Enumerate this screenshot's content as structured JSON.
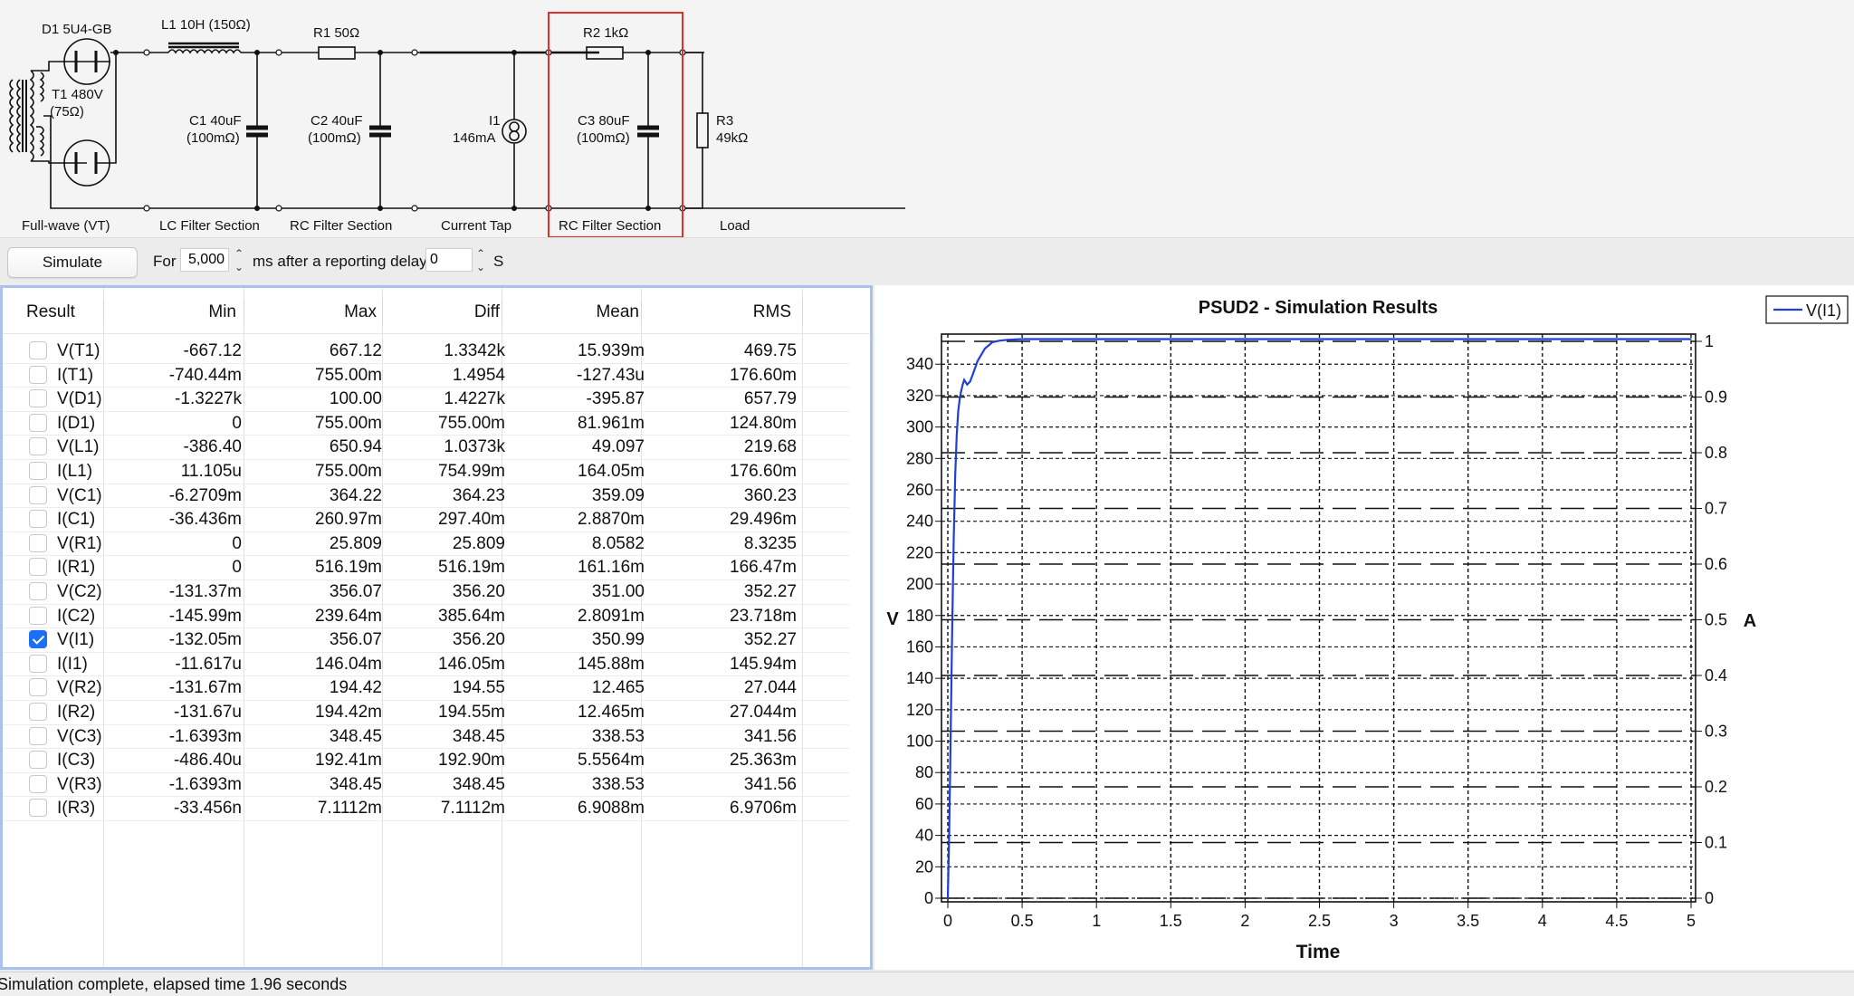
{
  "circuit": {
    "sections": [
      {
        "name": "Full-wave (VT)"
      },
      {
        "name": "LC Filter Section"
      },
      {
        "name": "RC Filter Section"
      },
      {
        "name": "Current Tap"
      },
      {
        "name": "RC Filter Section"
      },
      {
        "name": "Load"
      }
    ],
    "components": {
      "d1": "D1 5U4-GB",
      "t1_a": "T1 480V",
      "t1_b": "(75Ω)",
      "l1": "L1 10H (150Ω)",
      "r1": "R1 50Ω",
      "r2": "R2 1kΩ",
      "c1_a": "C1 40uF",
      "c1_b": "(100mΩ)",
      "c2_a": "C2 40uF",
      "c2_b": "(100mΩ)",
      "i1_a": "I1",
      "i1_b": "146mA",
      "c3_a": "C3 80uF",
      "c3_b": "(100mΩ)",
      "r3_a": "R3",
      "r3_b": "49kΩ"
    },
    "selected_section_color": "#e0302a"
  },
  "controls": {
    "simulate_label": "Simulate",
    "for_label": "For",
    "duration_value": "5,000",
    "delay_label": "ms after a reporting delay",
    "delay_value": "0",
    "delay_unit": "S"
  },
  "table": {
    "headers": [
      "Result",
      "Min",
      "Max",
      "Diff",
      "Mean",
      "RMS"
    ],
    "rows": [
      {
        "name": "V(T1)",
        "min": "-667.12",
        "max": "667.12",
        "diff": "1.3342k",
        "mean": "15.939m",
        "rms": "469.75",
        "checked": false
      },
      {
        "name": "I(T1)",
        "min": "-740.44m",
        "max": "755.00m",
        "diff": "1.4954",
        "mean": "-127.43u",
        "rms": "176.60m",
        "checked": false
      },
      {
        "name": "V(D1)",
        "min": "-1.3227k",
        "max": "100.00",
        "diff": "1.4227k",
        "mean": "-395.87",
        "rms": "657.79",
        "checked": false
      },
      {
        "name": "I(D1)",
        "min": "0",
        "max": "755.00m",
        "diff": "755.00m",
        "mean": "81.961m",
        "rms": "124.80m",
        "checked": false
      },
      {
        "name": "V(L1)",
        "min": "-386.40",
        "max": "650.94",
        "diff": "1.0373k",
        "mean": "49.097",
        "rms": "219.68",
        "checked": false
      },
      {
        "name": "I(L1)",
        "min": "11.105u",
        "max": "755.00m",
        "diff": "754.99m",
        "mean": "164.05m",
        "rms": "176.60m",
        "checked": false
      },
      {
        "name": "V(C1)",
        "min": "-6.2709m",
        "max": "364.22",
        "diff": "364.23",
        "mean": "359.09",
        "rms": "360.23",
        "checked": false
      },
      {
        "name": "I(C1)",
        "min": "-36.436m",
        "max": "260.97m",
        "diff": "297.40m",
        "mean": "2.8870m",
        "rms": "29.496m",
        "checked": false
      },
      {
        "name": "V(R1)",
        "min": "0",
        "max": "25.809",
        "diff": "25.809",
        "mean": "8.0582",
        "rms": "8.3235",
        "checked": false
      },
      {
        "name": "I(R1)",
        "min": "0",
        "max": "516.19m",
        "diff": "516.19m",
        "mean": "161.16m",
        "rms": "166.47m",
        "checked": false
      },
      {
        "name": "V(C2)",
        "min": "-131.37m",
        "max": "356.07",
        "diff": "356.20",
        "mean": "351.00",
        "rms": "352.27",
        "checked": false
      },
      {
        "name": "I(C2)",
        "min": "-145.99m",
        "max": "239.64m",
        "diff": "385.64m",
        "mean": "2.8091m",
        "rms": "23.718m",
        "checked": false
      },
      {
        "name": "V(I1)",
        "min": "-132.05m",
        "max": "356.07",
        "diff": "356.20",
        "mean": "350.99",
        "rms": "352.27",
        "checked": true
      },
      {
        "name": "I(I1)",
        "min": "-11.617u",
        "max": "146.04m",
        "diff": "146.05m",
        "mean": "145.88m",
        "rms": "145.94m",
        "checked": false
      },
      {
        "name": "V(R2)",
        "min": "-131.67m",
        "max": "194.42",
        "diff": "194.55",
        "mean": "12.465",
        "rms": "27.044",
        "checked": false
      },
      {
        "name": "I(R2)",
        "min": "-131.67u",
        "max": "194.42m",
        "diff": "194.55m",
        "mean": "12.465m",
        "rms": "27.044m",
        "checked": false
      },
      {
        "name": "V(C3)",
        "min": "-1.6393m",
        "max": "348.45",
        "diff": "348.45",
        "mean": "338.53",
        "rms": "341.56",
        "checked": false
      },
      {
        "name": "I(C3)",
        "min": "-486.40u",
        "max": "192.41m",
        "diff": "192.90m",
        "mean": "5.5564m",
        "rms": "25.363m",
        "checked": false
      },
      {
        "name": "V(R3)",
        "min": "-1.6393m",
        "max": "348.45",
        "diff": "348.45",
        "mean": "338.53",
        "rms": "341.56",
        "checked": false
      },
      {
        "name": "I(R3)",
        "min": "-33.456n",
        "max": "7.1112m",
        "diff": "7.1112m",
        "mean": "6.9088m",
        "rms": "6.9706m",
        "checked": false
      }
    ]
  },
  "chart_data": {
    "type": "line",
    "title": "PSUD2 - Simulation Results",
    "xlabel": "Time",
    "ylabel": "V",
    "y2label": "A",
    "xlim": [
      0,
      5
    ],
    "ylim": [
      0,
      360
    ],
    "y2lim": [
      0,
      1
    ],
    "x_ticks": [
      "0",
      "0.5",
      "1",
      "1.5",
      "2",
      "2.5",
      "3",
      "3.5",
      "4",
      "4.5",
      "5"
    ],
    "y_ticks": [
      "0",
      "20",
      "40",
      "60",
      "80",
      "100",
      "120",
      "140",
      "160",
      "180",
      "200",
      "220",
      "240",
      "260",
      "280",
      "300",
      "320",
      "340"
    ],
    "y2_ticks": [
      "0",
      "0.1",
      "0.2",
      "0.3",
      "0.4",
      "0.5",
      "0.6",
      "0.7",
      "0.8",
      "0.9",
      "1"
    ],
    "grid": true,
    "legend_position": "top-right",
    "series": [
      {
        "name": "V(I1)",
        "color": "#1f3fd6",
        "x": [
          0,
          0.01,
          0.02,
          0.03,
          0.04,
          0.05,
          0.06,
          0.07,
          0.08,
          0.09,
          0.1,
          0.11,
          0.13,
          0.15,
          0.17,
          0.2,
          0.25,
          0.3,
          0.35,
          0.4,
          0.5,
          0.6,
          1.0,
          1.5,
          2.0,
          2.5,
          3.0,
          3.5,
          4.0,
          4.5,
          5.0
        ],
        "y": [
          0,
          45,
          110,
          175,
          230,
          270,
          295,
          310,
          318,
          323,
          327,
          330,
          327,
          329,
          334,
          342,
          350,
          354,
          355,
          355.5,
          356,
          356,
          356,
          356,
          356,
          356,
          356,
          356,
          356,
          356,
          356
        ]
      }
    ]
  },
  "status": {
    "text": "Simulation complete, elapsed time 1.96 seconds"
  }
}
